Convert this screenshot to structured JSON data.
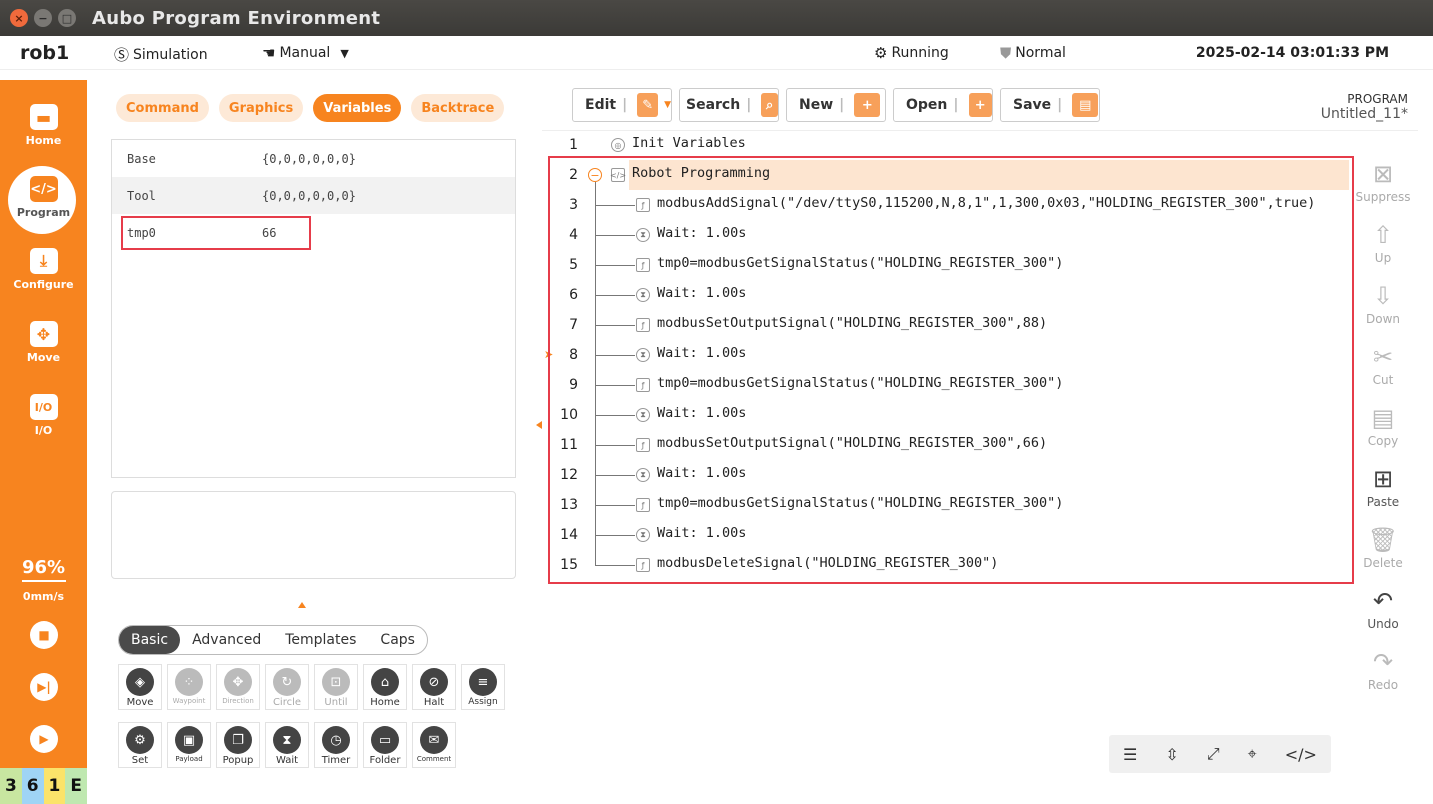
{
  "window": {
    "title": "Aubo Program Environment"
  },
  "status": {
    "robot": "rob1",
    "mode": "Simulation",
    "control": "Manual",
    "state": "Running",
    "safety": "Normal",
    "datetime": "2025-02-14 03:01:33 PM"
  },
  "nav": {
    "home": "Home",
    "program": "Program",
    "configure": "Configure",
    "move": "Move",
    "io": "I/O",
    "io_icon": "I/O"
  },
  "speed": {
    "percent": "96%",
    "rate": "0mm/s"
  },
  "counters": [
    "3",
    "6",
    "1",
    "E"
  ],
  "counter_colors": [
    "#c8e6a0",
    "#9fd4f5",
    "#fbe36a",
    "#bfe8b0"
  ],
  "left_tabs": [
    "Command",
    "Graphics",
    "Variables",
    "Backtrace"
  ],
  "variables": [
    {
      "name": "Base",
      "value": "{0,0,0,0,0,0}"
    },
    {
      "name": "Tool",
      "value": "{0,0,0,0,0,0}"
    },
    {
      "name": "tmp0",
      "value": "66"
    }
  ],
  "cmd_tabs": [
    "Basic",
    "Advanced",
    "Templates",
    "Caps"
  ],
  "commands": [
    {
      "label": "Move",
      "icon": "move-icon",
      "enabled": true
    },
    {
      "label": "Waypoint",
      "icon": "waypoint-icon",
      "enabled": false
    },
    {
      "label": "Direction",
      "icon": "direction-icon",
      "enabled": false
    },
    {
      "label": "Circle",
      "icon": "circle-icon",
      "enabled": false
    },
    {
      "label": "Until",
      "icon": "until-icon",
      "enabled": false
    },
    {
      "label": "Home",
      "icon": "home-icon",
      "enabled": true
    },
    {
      "label": "Halt",
      "icon": "halt-icon",
      "enabled": true
    },
    {
      "label": "Assign",
      "icon": "assign-icon",
      "enabled": true
    },
    {
      "label": "Set",
      "icon": "set-icon",
      "enabled": true
    },
    {
      "label": "Payload",
      "icon": "payload-icon",
      "enabled": true
    },
    {
      "label": "Popup",
      "icon": "popup-icon",
      "enabled": true
    },
    {
      "label": "Wait",
      "icon": "wait-icon",
      "enabled": true
    },
    {
      "label": "Timer",
      "icon": "timer-icon",
      "enabled": true
    },
    {
      "label": "Folder",
      "icon": "folder-icon",
      "enabled": true
    },
    {
      "label": "Comment",
      "icon": "comment-icon",
      "enabled": true
    }
  ],
  "toolbar": {
    "edit": "Edit",
    "search": "Search",
    "new": "New",
    "open": "Open",
    "save": "Save"
  },
  "program": {
    "label": "PROGRAM",
    "name": "Untitled_11*"
  },
  "program_lines": [
    {
      "n": "1",
      "text": "Init Variables"
    },
    {
      "n": "2",
      "text": "Robot Programming"
    },
    {
      "n": "3",
      "text": "modbusAddSignal(\"/dev/ttyS0,115200,N,8,1\",1,300,0x03,\"HOLDING_REGISTER_300\",true)"
    },
    {
      "n": "4",
      "text": "Wait: 1.00s"
    },
    {
      "n": "5",
      "text": "tmp0=modbusGetSignalStatus(\"HOLDING_REGISTER_300\")"
    },
    {
      "n": "6",
      "text": "Wait: 1.00s"
    },
    {
      "n": "7",
      "text": "modbusSetOutputSignal(\"HOLDING_REGISTER_300\",88)"
    },
    {
      "n": "8",
      "text": "Wait: 1.00s"
    },
    {
      "n": "9",
      "text": "tmp0=modbusGetSignalStatus(\"HOLDING_REGISTER_300\")"
    },
    {
      "n": "10",
      "text": "Wait: 1.00s"
    },
    {
      "n": "11",
      "text": "modbusSetOutputSignal(\"HOLDING_REGISTER_300\",66)"
    },
    {
      "n": "12",
      "text": "Wait: 1.00s"
    },
    {
      "n": "13",
      "text": "tmp0=modbusGetSignalStatus(\"HOLDING_REGISTER_300\")"
    },
    {
      "n": "14",
      "text": "Wait: 1.00s"
    },
    {
      "n": "15",
      "text": "modbusDeleteSignal(\"HOLDING_REGISTER_300\")"
    }
  ],
  "right_tools": [
    "Suppress",
    "Up",
    "Down",
    "Cut",
    "Copy",
    "Paste",
    "Delete",
    "Undo",
    "Redo"
  ],
  "accent": "#f7841f",
  "highlight": "#e63c4a"
}
